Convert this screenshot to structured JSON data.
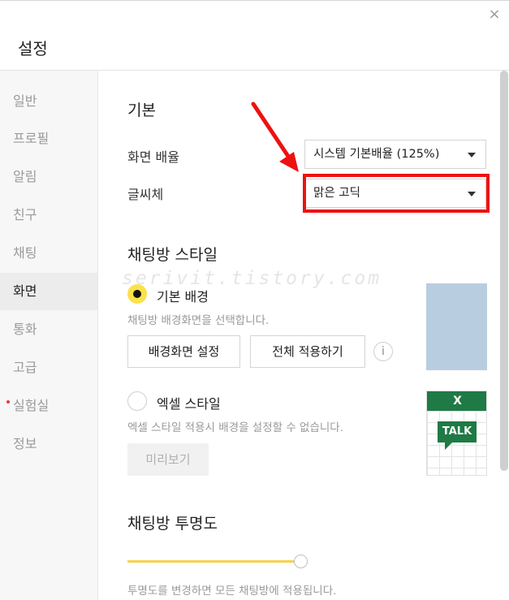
{
  "window": {
    "title": "설정",
    "close_symbol": "×"
  },
  "sidebar": {
    "items": [
      {
        "label": "일반"
      },
      {
        "label": "프로필"
      },
      {
        "label": "알림"
      },
      {
        "label": "친구"
      },
      {
        "label": "채팅"
      },
      {
        "label": "화면",
        "active": true
      },
      {
        "label": "통화"
      },
      {
        "label": "고급"
      },
      {
        "label": "실험실",
        "badge_dot": true
      },
      {
        "label": "정보"
      }
    ]
  },
  "basic": {
    "title": "기본",
    "zoom_label": "화면 배율",
    "zoom_value": "시스템 기본배율 (125%)",
    "font_label": "글씨체",
    "font_value": "맑은 고딕"
  },
  "chat_style": {
    "title": "채팅방 스타일",
    "basic_bg_label": "기본 배경",
    "basic_bg_hint": "채팅방 배경화면을 선택합니다.",
    "set_bg_button": "배경화면 설정",
    "apply_all_button": "전체 적용하기",
    "info_symbol": "i",
    "excel_label": "엑셀 스타일",
    "excel_hint": "엑셀 스타일 적용시 배경을 설정할 수 없습니다.",
    "preview_button": "미리보기",
    "excel_icon_text": "X",
    "talk_icon_text": "TALK",
    "selected_option": "기본 배경"
  },
  "opacity": {
    "title": "채팅방 투명도",
    "hint": "투명도를 변경하면 모든 채팅방에 적용됩니다.",
    "slider_value": 1.0
  },
  "watermark": "serivit.tistory.com",
  "colors": {
    "accent_yellow": "#fbe24a",
    "highlight_red": "#ee1111",
    "excel_green": "#1f7a45",
    "preview_blue": "#b9cde0"
  }
}
